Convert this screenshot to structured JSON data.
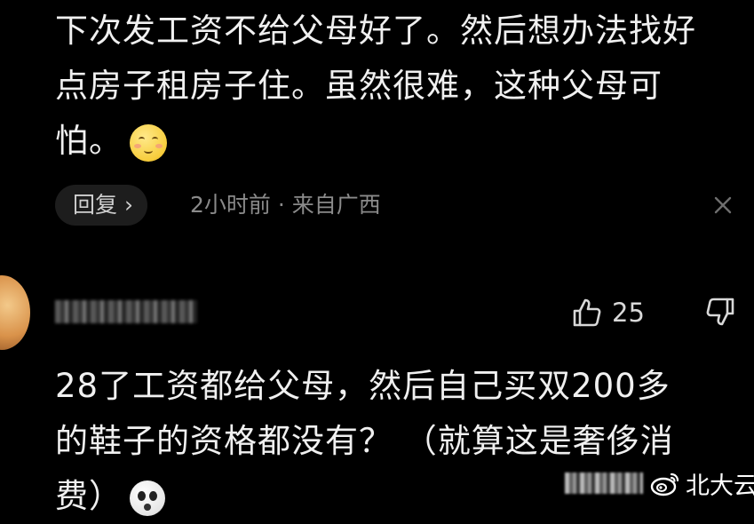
{
  "comments": [
    {
      "lines": [
        "下次发工资不给父母好了。然后想办法找好",
        "点房子租房子住。虽然很难，这种父母可",
        "怕。"
      ],
      "emoji": "smiling-face-emoji",
      "reply_label": "回复 ›",
      "time": "2小时前 · 来自广西",
      "close_icon": "close-icon"
    },
    {
      "likes": "25",
      "lines": [
        "28了工资都给父母，然后自己买双200多",
        "的鞋子的资格都没有？ （就算这是奢侈消",
        "费）"
      ],
      "emoji": "shocked-face-emoji",
      "like_icon": "thumbs-up-icon",
      "dislike_icon": "thumbs-down-icon"
    }
  ],
  "watermark": {
    "text": "北大云龙",
    "icon": "weibo-icon"
  },
  "colors": {
    "background": "#000000",
    "text": "#f0f0f0",
    "muted": "#8a8a8a",
    "reply_bg": "#1d1d1d"
  }
}
